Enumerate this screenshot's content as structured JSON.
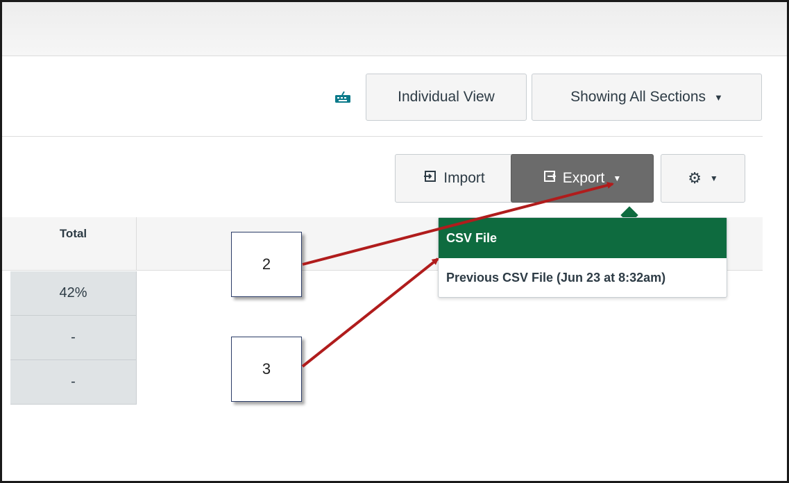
{
  "toolbar": {
    "keyboard_icon": "keyboard-icon",
    "individual_view_label": "Individual View",
    "sections_label": "Showing All Sections",
    "import_label": "Import",
    "export_label": "Export",
    "settings_icon": "gear-icon"
  },
  "gradebook": {
    "total_header": "Total",
    "rows": [
      "42%",
      "-",
      "-"
    ]
  },
  "export_menu": {
    "items": [
      "CSV File",
      "Previous CSV File (Jun 23 at 8:32am)"
    ],
    "highlight_color": "#0e6b3f"
  },
  "annotations": {
    "callout_2": "2",
    "callout_3": "3",
    "arrow_color": "#b01c1c"
  }
}
